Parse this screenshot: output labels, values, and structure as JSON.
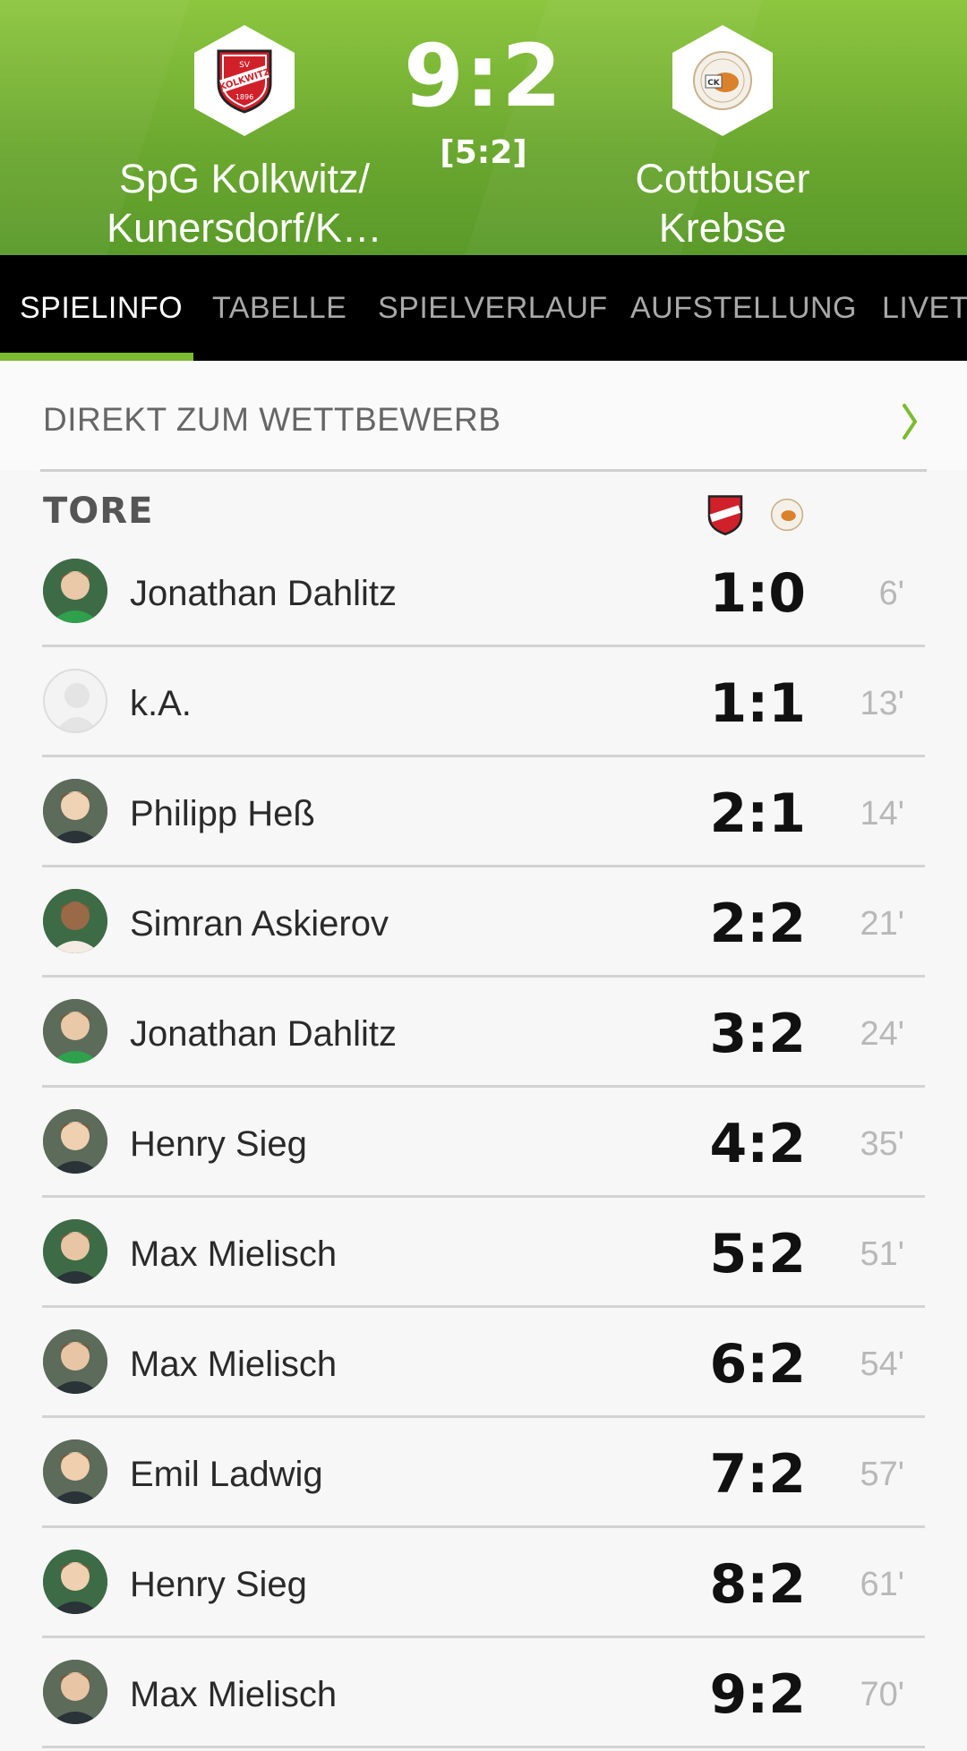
{
  "header": {
    "home_name": "SpG Kolkwitz/\nKunersdorf/K…",
    "away_name": "Cottbuser\nKrebse",
    "score": "9:2",
    "halftime": "[5:2]",
    "home_crest_text": "KOLKWITZ",
    "home_crest_small": "SV",
    "home_crest_year": "1896",
    "away_crest_text": "CK"
  },
  "tabs": [
    "SPIELINFO",
    "TABELLE",
    "SPIELVERLAUF",
    "AUFSTELLUNG",
    "LIVET"
  ],
  "direkt_label": "DIREKT ZUM WETTBEWERB",
  "tore_title": "TORE",
  "goals": [
    {
      "player": "Jonathan Dahlitz",
      "score": "1:0",
      "minute": "6'"
    },
    {
      "player": "k.A.",
      "score": "1:1",
      "minute": "13'"
    },
    {
      "player": "Philipp Heß",
      "score": "2:1",
      "minute": "14'"
    },
    {
      "player": "Simran Askierov",
      "score": "2:2",
      "minute": "21'"
    },
    {
      "player": "Jonathan Dahlitz",
      "score": "3:2",
      "minute": "24'"
    },
    {
      "player": "Henry Sieg",
      "score": "4:2",
      "minute": "35'"
    },
    {
      "player": "Max Mielisch",
      "score": "5:2",
      "minute": "51'"
    },
    {
      "player": "Max Mielisch",
      "score": "6:2",
      "minute": "54'"
    },
    {
      "player": "Emil Ladwig",
      "score": "7:2",
      "minute": "57'"
    },
    {
      "player": "Henry Sieg",
      "score": "8:2",
      "minute": "61'"
    },
    {
      "player": "Max Mielisch",
      "score": "9:2",
      "minute": "70'"
    }
  ],
  "colors": {
    "accent": "#7cbb31",
    "header": "#6aa72f",
    "tabbar": "#000000"
  }
}
